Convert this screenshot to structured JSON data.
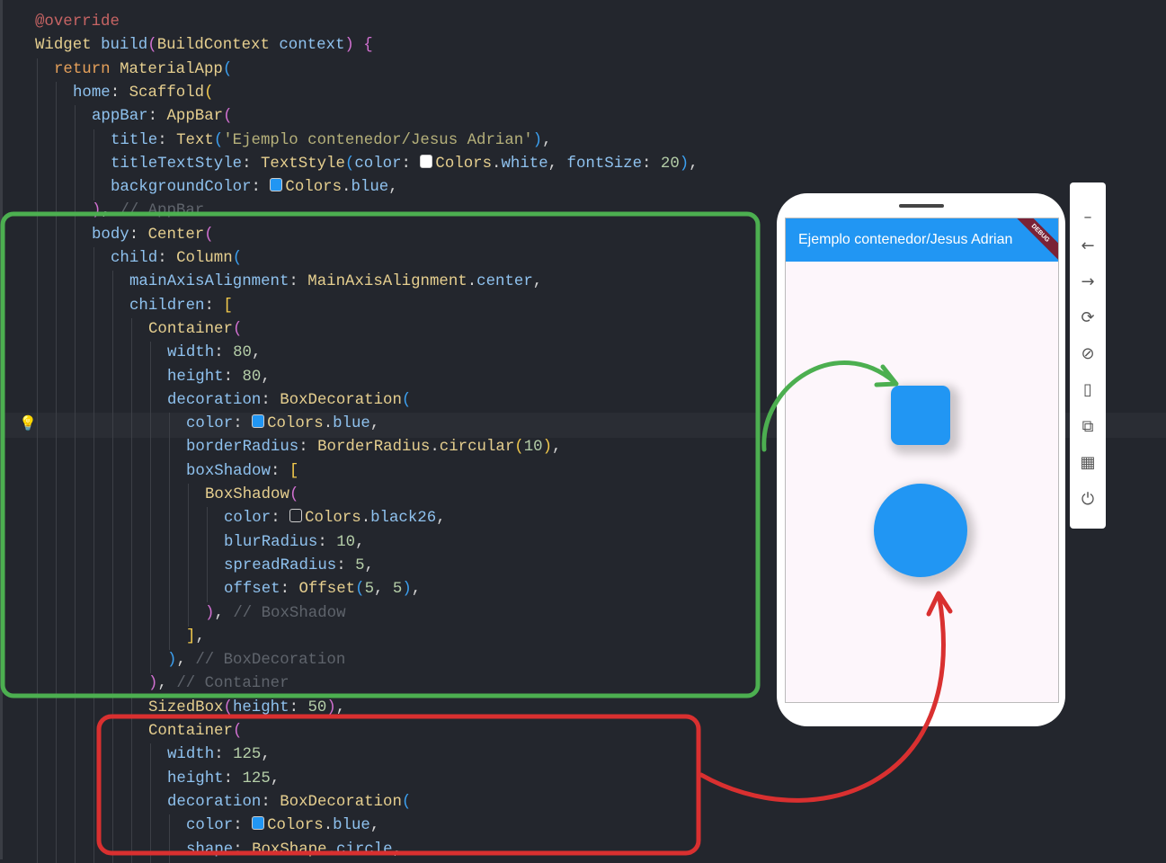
{
  "code": [
    {
      "indent": 0,
      "tokens": [
        [
          "o",
          "@override"
        ]
      ]
    },
    {
      "indent": 0,
      "tokens": [
        [
          "c",
          "Widget "
        ],
        [
          "p",
          "build"
        ],
        [
          "pu",
          "("
        ],
        [
          "c",
          "BuildContext "
        ],
        [
          "p",
          "context"
        ],
        [
          "pu",
          ")"
        ],
        [
          "w",
          " "
        ],
        [
          "pu",
          "{"
        ]
      ]
    },
    {
      "indent": 1,
      "tokens": [
        [
          "k",
          "return "
        ],
        [
          "c",
          "MaterialApp"
        ],
        [
          "b",
          "("
        ]
      ]
    },
    {
      "indent": 2,
      "tokens": [
        [
          "p",
          "home"
        ],
        [
          "w",
          ": "
        ],
        [
          "c",
          "Scaffold"
        ],
        [
          "y",
          "("
        ]
      ]
    },
    {
      "indent": 3,
      "tokens": [
        [
          "p",
          "appBar"
        ],
        [
          "w",
          ": "
        ],
        [
          "c",
          "AppBar"
        ],
        [
          "pu",
          "("
        ]
      ]
    },
    {
      "indent": 4,
      "tokens": [
        [
          "p",
          "title"
        ],
        [
          "w",
          ": "
        ],
        [
          "c",
          "Text"
        ],
        [
          "b",
          "("
        ],
        [
          "s",
          "'Ejemplo contenedor/Jesus Adrian'"
        ],
        [
          "b",
          ")"
        ],
        [
          "w",
          ","
        ]
      ]
    },
    {
      "indent": 4,
      "tokens": [
        [
          "p",
          "titleTextStyle"
        ],
        [
          "w",
          ": "
        ],
        [
          "c",
          "TextStyle"
        ],
        [
          "b",
          "("
        ],
        [
          "p",
          "color"
        ],
        [
          "w",
          ": "
        ],
        [
          "sw",
          "#ffffff"
        ],
        [
          "c",
          "Colors"
        ],
        [
          "w",
          "."
        ],
        [
          "p",
          "white"
        ],
        [
          "w",
          ", "
        ],
        [
          "p",
          "fontSize"
        ],
        [
          "w",
          ": "
        ],
        [
          "n",
          "20"
        ],
        [
          "b",
          ")"
        ],
        [
          "w",
          ","
        ]
      ]
    },
    {
      "indent": 4,
      "tokens": [
        [
          "p",
          "backgroundColor"
        ],
        [
          "w",
          ": "
        ],
        [
          "sw",
          "#2196f3"
        ],
        [
          "c",
          "Colors"
        ],
        [
          "w",
          "."
        ],
        [
          "p",
          "blue"
        ],
        [
          "w",
          ","
        ]
      ]
    },
    {
      "indent": 3,
      "tokens": [
        [
          "pu",
          ")"
        ],
        [
          "w",
          ", "
        ],
        [
          "cm",
          "// AppBar"
        ]
      ]
    },
    {
      "indent": 3,
      "tokens": [
        [
          "p",
          "body"
        ],
        [
          "w",
          ": "
        ],
        [
          "c",
          "Center"
        ],
        [
          "pu",
          "("
        ]
      ]
    },
    {
      "indent": 4,
      "tokens": [
        [
          "p",
          "child"
        ],
        [
          "w",
          ": "
        ],
        [
          "c",
          "Column"
        ],
        [
          "b",
          "("
        ]
      ]
    },
    {
      "indent": 5,
      "tokens": [
        [
          "p",
          "mainAxisAlignment"
        ],
        [
          "w",
          ": "
        ],
        [
          "c",
          "MainAxisAlignment"
        ],
        [
          "w",
          "."
        ],
        [
          "p",
          "center"
        ],
        [
          "w",
          ","
        ]
      ]
    },
    {
      "indent": 5,
      "tokens": [
        [
          "p",
          "children"
        ],
        [
          "w",
          ": "
        ],
        [
          "y",
          "["
        ]
      ]
    },
    {
      "indent": 6,
      "tokens": [
        [
          "c",
          "Container"
        ],
        [
          "pu",
          "("
        ]
      ]
    },
    {
      "indent": 7,
      "tokens": [
        [
          "p",
          "width"
        ],
        [
          "w",
          ": "
        ],
        [
          "n",
          "80"
        ],
        [
          "w",
          ","
        ]
      ]
    },
    {
      "indent": 7,
      "tokens": [
        [
          "p",
          "height"
        ],
        [
          "w",
          ": "
        ],
        [
          "n",
          "80"
        ],
        [
          "w",
          ","
        ]
      ]
    },
    {
      "indent": 7,
      "tokens": [
        [
          "p",
          "decoration"
        ],
        [
          "w",
          ": "
        ],
        [
          "c",
          "BoxDecoration"
        ],
        [
          "b",
          "("
        ]
      ]
    },
    {
      "indent": 8,
      "tokens": [
        [
          "p",
          "color"
        ],
        [
          "w",
          ": "
        ],
        [
          "sw",
          "#2196f3"
        ],
        [
          "c",
          "Colors"
        ],
        [
          "w",
          "."
        ],
        [
          "p",
          "blue"
        ],
        [
          "w",
          ","
        ]
      ]
    },
    {
      "indent": 8,
      "tokens": [
        [
          "p",
          "borderRadius"
        ],
        [
          "w",
          ": "
        ],
        [
          "c",
          "BorderRadius"
        ],
        [
          "w",
          "."
        ],
        [
          "c",
          "circular"
        ],
        [
          "y",
          "("
        ],
        [
          "n",
          "10"
        ],
        [
          "y",
          ")"
        ],
        [
          "w",
          ","
        ]
      ]
    },
    {
      "indent": 8,
      "tokens": [
        [
          "p",
          "boxShadow"
        ],
        [
          "w",
          ": "
        ],
        [
          "y",
          "["
        ]
      ]
    },
    {
      "indent": 9,
      "tokens": [
        [
          "c",
          "BoxShadow"
        ],
        [
          "pu",
          "("
        ]
      ]
    },
    {
      "indent": 10,
      "tokens": [
        [
          "p",
          "color"
        ],
        [
          "w",
          ": "
        ],
        [
          "sw",
          "#23262d"
        ],
        [
          "c",
          "Colors"
        ],
        [
          "w",
          "."
        ],
        [
          "p",
          "black26"
        ],
        [
          "w",
          ","
        ]
      ]
    },
    {
      "indent": 10,
      "tokens": [
        [
          "p",
          "blurRadius"
        ],
        [
          "w",
          ": "
        ],
        [
          "n",
          "10"
        ],
        [
          "w",
          ","
        ]
      ]
    },
    {
      "indent": 10,
      "tokens": [
        [
          "p",
          "spreadRadius"
        ],
        [
          "w",
          ": "
        ],
        [
          "n",
          "5"
        ],
        [
          "w",
          ","
        ]
      ]
    },
    {
      "indent": 10,
      "tokens": [
        [
          "p",
          "offset"
        ],
        [
          "w",
          ": "
        ],
        [
          "c",
          "Offset"
        ],
        [
          "b",
          "("
        ],
        [
          "n",
          "5"
        ],
        [
          "w",
          ", "
        ],
        [
          "n",
          "5"
        ],
        [
          "b",
          ")"
        ],
        [
          "w",
          ","
        ]
      ]
    },
    {
      "indent": 9,
      "tokens": [
        [
          "pu",
          ")"
        ],
        [
          "w",
          ", "
        ],
        [
          "cm",
          "// BoxShadow"
        ]
      ]
    },
    {
      "indent": 8,
      "tokens": [
        [
          "y",
          "]"
        ],
        [
          "w",
          ","
        ]
      ]
    },
    {
      "indent": 7,
      "tokens": [
        [
          "b",
          ")"
        ],
        [
          "w",
          ", "
        ],
        [
          "cm",
          "// BoxDecoration"
        ]
      ]
    },
    {
      "indent": 6,
      "tokens": [
        [
          "pu",
          ")"
        ],
        [
          "w",
          ", "
        ],
        [
          "cm",
          "// Container"
        ]
      ]
    },
    {
      "indent": 6,
      "tokens": [
        [
          "c",
          "SizedBox"
        ],
        [
          "pu",
          "("
        ],
        [
          "p",
          "height"
        ],
        [
          "w",
          ": "
        ],
        [
          "n",
          "50"
        ],
        [
          "pu",
          ")"
        ],
        [
          "w",
          ","
        ]
      ]
    },
    {
      "indent": 6,
      "tokens": [
        [
          "c",
          "Container"
        ],
        [
          "pu",
          "("
        ]
      ]
    },
    {
      "indent": 7,
      "tokens": [
        [
          "p",
          "width"
        ],
        [
          "w",
          ": "
        ],
        [
          "n",
          "125"
        ],
        [
          "w",
          ","
        ]
      ]
    },
    {
      "indent": 7,
      "tokens": [
        [
          "p",
          "height"
        ],
        [
          "w",
          ": "
        ],
        [
          "n",
          "125"
        ],
        [
          "w",
          ","
        ]
      ]
    },
    {
      "indent": 7,
      "tokens": [
        [
          "p",
          "decoration"
        ],
        [
          "w",
          ": "
        ],
        [
          "c",
          "BoxDecoration"
        ],
        [
          "b",
          "("
        ]
      ]
    },
    {
      "indent": 8,
      "tokens": [
        [
          "p",
          "color"
        ],
        [
          "w",
          ": "
        ],
        [
          "sw",
          "#2196f3"
        ],
        [
          "c",
          "Colors"
        ],
        [
          "w",
          "."
        ],
        [
          "p",
          "blue"
        ],
        [
          "w",
          ","
        ]
      ]
    },
    {
      "indent": 8,
      "tokens": [
        [
          "p",
          "shape"
        ],
        [
          "w",
          ": "
        ],
        [
          "c",
          "BoxShape"
        ],
        [
          "w",
          "."
        ],
        [
          "p",
          "circle"
        ],
        [
          "w",
          ","
        ]
      ]
    }
  ],
  "emulator": {
    "app_title": "Ejemplo contenedor/Jesus Adrian",
    "debug_banner": "DEBUG"
  },
  "toolbar": [
    "minimize-icon",
    "back-icon",
    "forward-icon",
    "rotate-icon",
    "rotate-device-icon",
    "screenshot-icon",
    "open-external-icon",
    "qr-code-icon",
    "power-icon"
  ],
  "colors": {
    "green_annotation": "#4caf50",
    "red_annotation": "#d93030",
    "flutter_blue": "#2196f3"
  }
}
